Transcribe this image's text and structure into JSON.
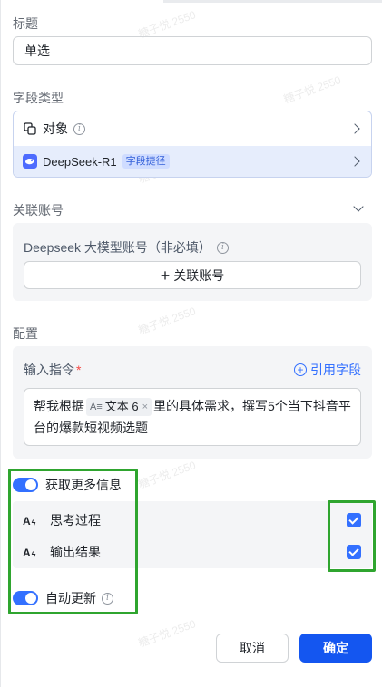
{
  "title_section": {
    "label": "标题",
    "value": "单选"
  },
  "field_type": {
    "label": "字段类型",
    "type_name": "对象",
    "model_name": "DeepSeek-R1",
    "model_tag": "字段捷径"
  },
  "linked_account": {
    "label": "关联账号",
    "account_title": "Deepseek 大模型账号（非必填）",
    "link_button": "关联账号"
  },
  "config": {
    "label": "配置",
    "prompt_label": "输入指令",
    "required_mark": "*",
    "ref_field_label": "引用字段",
    "prompt_before": "帮我根据",
    "chip_icon": "A≡",
    "chip_label": "文本 6",
    "chip_close": "×",
    "prompt_after": "里的具体需求，撰写5个当下抖音平台的爆款短视频选题"
  },
  "more_info": {
    "toggle_label": "获取更多信息",
    "toggle_on": true,
    "options": [
      {
        "label": "思考过程",
        "checked": true
      },
      {
        "label": "输出结果",
        "checked": true
      }
    ]
  },
  "auto_update": {
    "label": "自动更新",
    "toggle_on": true
  },
  "footer": {
    "cancel": "取消",
    "confirm": "确定"
  },
  "watermark": "糖子悦 2550",
  "colors": {
    "accent": "#3370ff",
    "highlight": "#2fa52f",
    "primary_button": "#1456f0"
  }
}
